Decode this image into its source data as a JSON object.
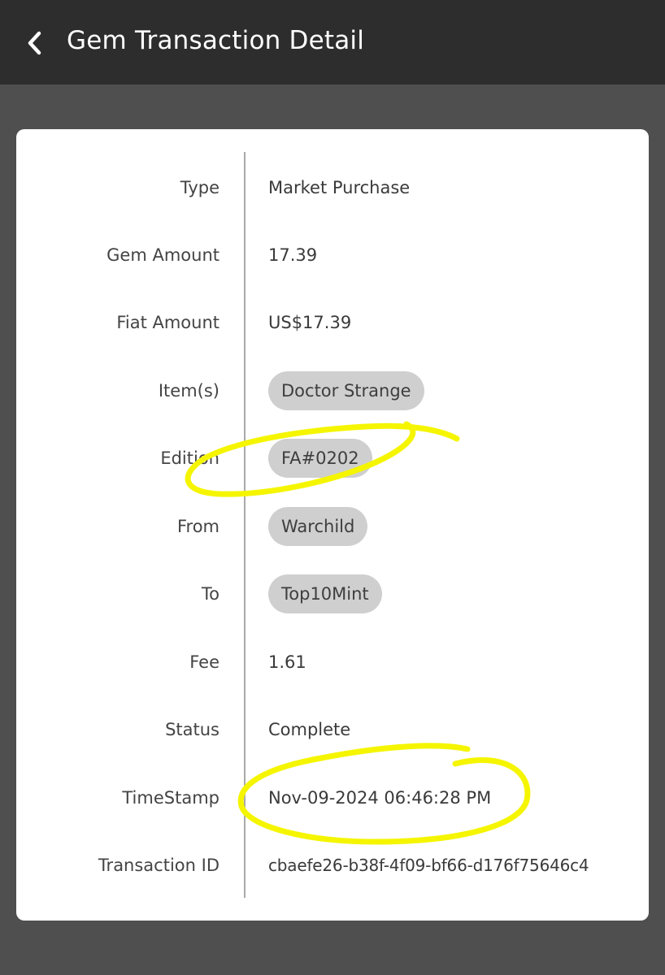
{
  "header": {
    "title": "Gem Transaction Detail",
    "back_icon": "chevron-left-icon"
  },
  "details": [
    {
      "label": "Type",
      "value": "Market Purchase",
      "kind": "text"
    },
    {
      "label": "Gem Amount",
      "value": "17.39",
      "kind": "text"
    },
    {
      "label": "Fiat Amount",
      "value": "US$17.39",
      "kind": "text"
    },
    {
      "label": "Item(s)",
      "value": "Doctor Strange",
      "kind": "chip"
    },
    {
      "label": "Edition",
      "value": "FA#0202",
      "kind": "chip"
    },
    {
      "label": "From",
      "value": "Warchild",
      "kind": "chip"
    },
    {
      "label": "To",
      "value": "Top10Mint",
      "kind": "chip"
    },
    {
      "label": "Fee",
      "value": "1.61",
      "kind": "text"
    },
    {
      "label": "Status",
      "value": "Complete",
      "kind": "text"
    },
    {
      "label": "TimeStamp",
      "value": "Nov-09-2024 06:46:28 PM",
      "kind": "text"
    },
    {
      "label": "Transaction ID",
      "value": "cbaefe26-b38f-4f09-bf66-d176f75646c4",
      "kind": "text"
    }
  ],
  "colors": {
    "header_bg": "#2d2d2d",
    "page_bg": "#4f4f4f",
    "card_bg": "#ffffff",
    "chip_bg": "#cfcfcf",
    "annotation": "#f5f500"
  }
}
